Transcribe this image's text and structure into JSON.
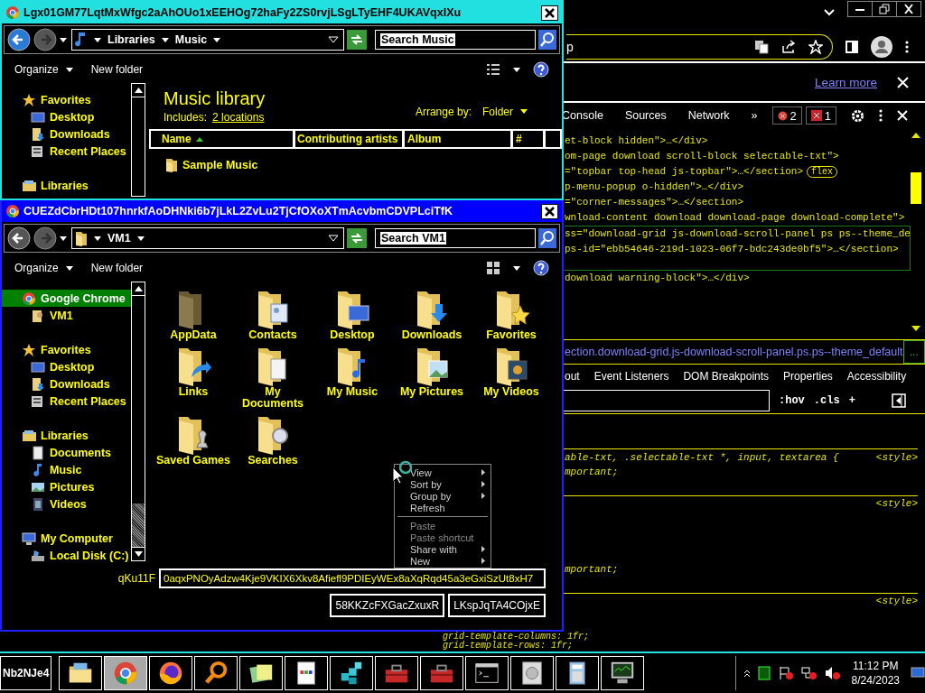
{
  "chrome_window": {
    "address_text": "p",
    "infobar": {
      "link": "Learn more"
    },
    "devtools": {
      "tabs": [
        {
          "label": "Console",
          "selected": false
        },
        {
          "label": "Sources",
          "selected": false
        },
        {
          "label": "Network",
          "selected": false
        }
      ],
      "more_tabs": "»",
      "error_count": "2",
      "issue_count": "1",
      "dom_nodes": [
        {
          "lines": [
            "et-block hidden\">…</div>"
          ],
          "selected": false
        },
        {
          "lines": [
            "om-page download scroll-block selectable-txt\">"
          ],
          "selected": false
        },
        {
          "lines": [
            "=\"topbar top-head js-topbar\">…</section>"
          ],
          "selected": false,
          "badge": "flex"
        },
        {
          "lines": [
            "p-menu-popup o-hidden\">…</div>"
          ],
          "selected": false
        },
        {
          "lines": [
            "=\"corner-messages\">…</section>"
          ],
          "selected": false
        },
        {
          "lines": [
            "wnload-content download download-page download-complete\">"
          ],
          "selected": false
        },
        {
          "lines": [
            "ss=\"download-grid js-download-scroll-panel ps ps--theme_de",
            "ps-id=\"ebb54646-219d-1023-06f7-bdc243de0bf5\">…</section>"
          ],
          "selected": true
        },
        {
          "lines": [
            "download warning-block\">…</div>"
          ],
          "selected": false
        }
      ],
      "breadcrumb": "ection.download-grid.js-download-scroll-panel.ps.ps--theme_default",
      "breadcrumb_more": "...",
      "side_tabs": [
        "out",
        "Event Listeners",
        "DOM Breakpoints",
        "Properties",
        "Accessibility"
      ],
      "filter_buttons": [
        ":hov",
        ".cls",
        "+"
      ],
      "style_rules": [
        {
          "lines": [
            "able-txt, .selectable-txt *, input, textarea {",
            "mportant;"
          ],
          "source": "<style>"
        },
        {
          "lines": [
            "mportant;"
          ],
          "source": "<style>"
        },
        {
          "lines": [
            "grid-template-columns: 1fr;",
            "grid-template-rows: 1fr;"
          ],
          "source": "<style>"
        }
      ]
    }
  },
  "explorer_windows": [
    {
      "title": "Lgx01GM77LqtMxWfgc2aAhOUo1xEEHOg72haFy2ZS0rvjLSgLTyEHF4UKAVqxIXu",
      "active": false,
      "back_enabled": true,
      "breadcrumb": [
        "Libraries",
        "Music"
      ],
      "search_label": "Search Music",
      "commands": [
        {
          "label": "Organize",
          "menu": true
        },
        {
          "label": "New folder",
          "menu": false
        }
      ],
      "nav": [
        {
          "label": "Favorites",
          "kind": "star",
          "selected": false,
          "children": [
            {
              "label": "Desktop",
              "kind": "desktop",
              "selected": false
            },
            {
              "label": "Downloads",
              "kind": "downloads",
              "selected": false
            },
            {
              "label": "Recent Places",
              "kind": "recent",
              "selected": false
            }
          ]
        },
        {
          "label": "Libraries",
          "kind": "libraries",
          "selected": false
        }
      ],
      "content": {
        "kind": "library",
        "heading": "Music library",
        "includes_label": "Includes:",
        "includes_link": "2 locations",
        "arrange_label": "Arrange by:",
        "arrange_value": "Folder",
        "columns": [
          {
            "label": "Name",
            "sorted": true
          },
          {
            "label": "Contributing artists",
            "sorted": false
          },
          {
            "label": "Album",
            "sorted": false
          },
          {
            "label": "#",
            "sorted": false
          }
        ],
        "rows": [
          {
            "name": "Sample Music"
          }
        ]
      }
    },
    {
      "title": "CUEZdCbrHDt107hnrkfAoDHNki6b7jLkL2ZvLu2TjCfOXoXTmAcvbmCDVPLciTfK",
      "active": true,
      "back_enabled": false,
      "breadcrumb": [
        "VM1"
      ],
      "search_label": "Search VM1",
      "commands": [
        {
          "label": "Organize",
          "menu": true
        },
        {
          "label": "New folder",
          "menu": false
        }
      ],
      "nav": [
        {
          "label": "Google Chrome",
          "kind": "chrome",
          "selected": true,
          "children": [
            {
              "label": "VM1",
              "kind": "user",
              "selected": false
            }
          ]
        },
        {
          "label": "Favorites",
          "kind": "star",
          "selected": false,
          "children": [
            {
              "label": "Desktop",
              "kind": "desktop",
              "selected": false
            },
            {
              "label": "Downloads",
              "kind": "downloads",
              "selected": false
            },
            {
              "label": "Recent Places",
              "kind": "recent",
              "selected": false
            }
          ]
        },
        {
          "label": "Libraries",
          "kind": "libraries",
          "selected": false,
          "children": [
            {
              "label": "Documents",
              "kind": "documents",
              "selected": false
            },
            {
              "label": "Music",
              "kind": "music",
              "selected": false
            },
            {
              "label": "Pictures",
              "kind": "pictures",
              "selected": false
            },
            {
              "label": "Videos",
              "kind": "videos",
              "selected": false
            }
          ]
        },
        {
          "label": "My Computer",
          "kind": "computer",
          "selected": false,
          "children": [
            {
              "label": "Local Disk (C:)",
              "kind": "disk",
              "selected": false
            }
          ]
        }
      ],
      "content": {
        "kind": "icons",
        "items": [
          {
            "label": "AppData",
            "kind": "appdata"
          },
          {
            "label": "Contacts",
            "kind": "contacts"
          },
          {
            "label": "Desktop",
            "kind": "desktop"
          },
          {
            "label": "Downloads",
            "kind": "downloads"
          },
          {
            "label": "Favorites",
            "kind": "favorites"
          },
          {
            "label": "Links",
            "kind": "links"
          },
          {
            "label": "My Documents",
            "kind": "documents"
          },
          {
            "label": "My Music",
            "kind": "music"
          },
          {
            "label": "My Pictures",
            "kind": "pictures"
          },
          {
            "label": "My Videos",
            "kind": "videos"
          },
          {
            "label": "Saved Games",
            "kind": "games"
          },
          {
            "label": "Searches",
            "kind": "searches"
          }
        ]
      },
      "form": {
        "label": "qKu11F",
        "value": "0aqxPNOyAdzw4Kje9VKIX6Xkv8Afiefl9PDIEyWEx8aXqRqd45a3eGxiSzUt8xH7",
        "fields": [
          "58KKZcFXGacZxuxR",
          "LKspJqTA4COjxE"
        ]
      }
    }
  ],
  "context_menu": {
    "items": [
      {
        "kind": "item",
        "label": "View",
        "submenu": true,
        "disabled": false
      },
      {
        "kind": "item",
        "label": "Sort by",
        "submenu": true,
        "disabled": false
      },
      {
        "kind": "item",
        "label": "Group by",
        "submenu": true,
        "disabled": false
      },
      {
        "kind": "item",
        "label": "Refresh",
        "submenu": false,
        "disabled": false
      },
      {
        "kind": "separator"
      },
      {
        "kind": "item",
        "label": "Paste",
        "submenu": false,
        "disabled": true
      },
      {
        "kind": "item",
        "label": "Paste shortcut",
        "submenu": false,
        "disabled": true
      },
      {
        "kind": "item",
        "label": "Share with",
        "submenu": true,
        "disabled": false
      },
      {
        "kind": "item",
        "label": "New",
        "submenu": true,
        "disabled": false
      }
    ]
  },
  "taskbar": {
    "start_label": "Nb2NJe4",
    "apps": [
      {
        "kind": "explorer",
        "selected": false
      },
      {
        "kind": "chrome",
        "selected": true
      },
      {
        "kind": "firefox",
        "selected": false
      },
      {
        "kind": "magnifier",
        "selected": false
      },
      {
        "kind": "notes",
        "selected": false
      },
      {
        "kind": "document",
        "selected": false
      },
      {
        "kind": "registry",
        "selected": false
      },
      {
        "kind": "toolbox",
        "selected": false
      },
      {
        "kind": "toolbox",
        "selected": false
      },
      {
        "kind": "console",
        "selected": false
      },
      {
        "kind": "disk",
        "selected": false
      },
      {
        "kind": "calculator",
        "selected": false
      },
      {
        "kind": "monitor",
        "selected": false
      }
    ],
    "clock": {
      "time": "11:12 PM",
      "date": "8/24/2023"
    }
  }
}
